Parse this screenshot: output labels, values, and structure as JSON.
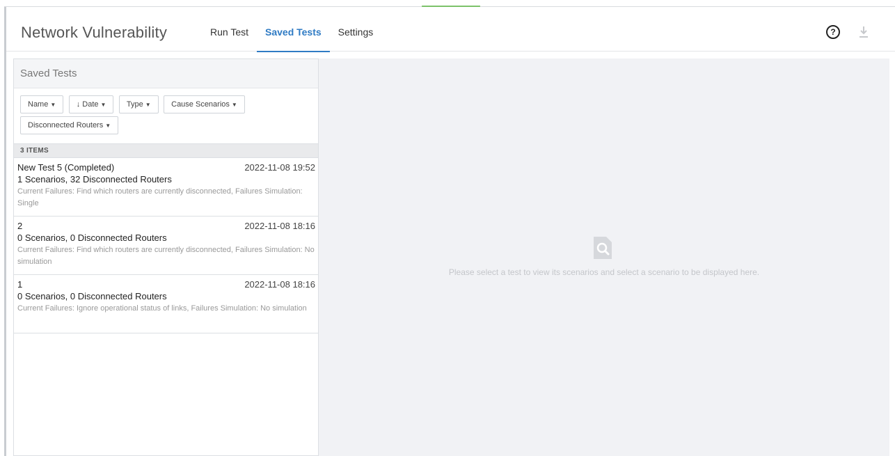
{
  "header": {
    "app_title": "Network Vulnerability",
    "tabs": [
      {
        "label": "Run Test",
        "active": false
      },
      {
        "label": "Saved Tests",
        "active": true
      },
      {
        "label": "Settings",
        "active": false
      }
    ],
    "help_icon": "question-circle-icon",
    "help_glyph": "?",
    "download_icon": "download-icon"
  },
  "colors": {
    "accent": "#2f7bc4",
    "status_green": "#7cc26a",
    "panel_bg": "#f1f2f5"
  },
  "saved_tests": {
    "title": "Saved Tests",
    "filters": [
      "Name",
      "↓ Date",
      "Type",
      "Cause Scenarios",
      "Disconnected Routers"
    ],
    "caret_glyph": "▼",
    "items_count_label": "3 ITEMS",
    "items": [
      {
        "name": "New Test 5 (Completed)",
        "date": "2022-11-08 19:52",
        "summary": "1 Scenarios, 32 Disconnected Routers",
        "description": "Current Failures: Find which routers are currently disconnected, Failures Simulation: Single"
      },
      {
        "name": "2",
        "date": "2022-11-08 18:16",
        "summary": "0 Scenarios, 0 Disconnected Routers",
        "description": "Current Failures: Find which routers are currently disconnected, Failures Simulation: No simulation"
      },
      {
        "name": "1",
        "date": "2022-11-08 18:16",
        "summary": "0 Scenarios, 0 Disconnected Routers",
        "description": "Current Failures: Ignore operational status of links, Failures Simulation: No simulation"
      }
    ]
  },
  "detail": {
    "empty_icon": "search-document-icon",
    "empty_message": "Please select a test to view its scenarios and select a scenario to be displayed here."
  }
}
